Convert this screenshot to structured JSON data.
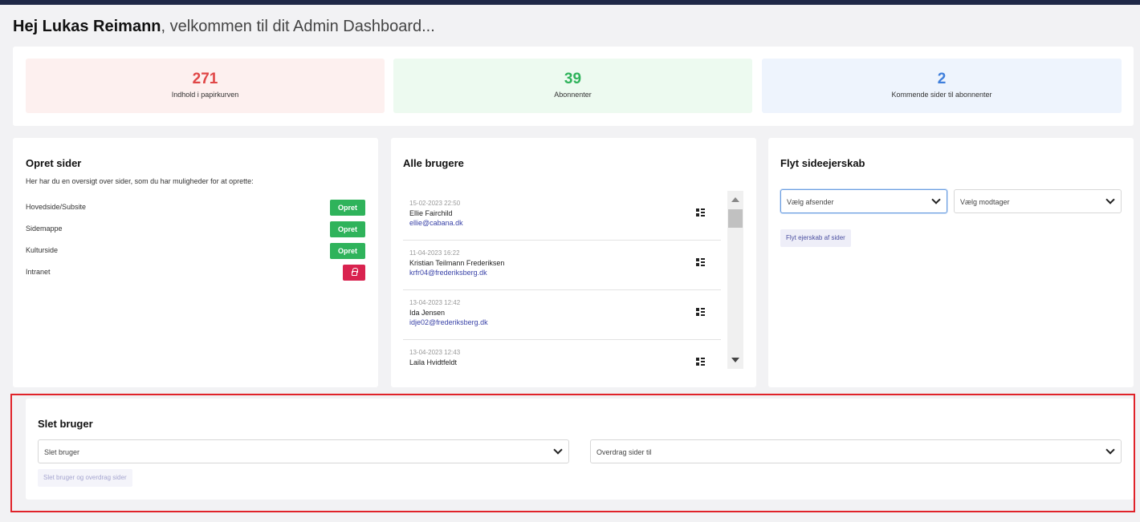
{
  "greeting": {
    "name": "Hej Lukas Reimann",
    "rest": ", velkommen til dit Admin Dashboard..."
  },
  "stats": [
    {
      "value": "271",
      "label": "Indhold i papirkurven",
      "color": "#e04747"
    },
    {
      "value": "39",
      "label": "Abonnenter",
      "color": "#2fb35b"
    },
    {
      "value": "2",
      "label": "Kommende sider til abonnenter",
      "color": "#3f7fdc"
    }
  ],
  "opret": {
    "title": "Opret sider",
    "description": "Her har du en oversigt over sider, som du har muligheder for at oprette:",
    "rows": [
      {
        "name": "Hovedside/Subsite",
        "button": "Opret",
        "locked": false
      },
      {
        "name": "Sidemappe",
        "button": "Opret",
        "locked": false
      },
      {
        "name": "Kulturside",
        "button": "Opret",
        "locked": false
      },
      {
        "name": "Intranet",
        "button": "",
        "locked": true,
        "icon": "lock-icon"
      }
    ]
  },
  "users": {
    "title": "Alle brugere",
    "items": [
      {
        "date": "15-02-2023 22:50",
        "name": "Ellie Fairchild",
        "email": "ellie@cabana.dk"
      },
      {
        "date": "11-04-2023 16:22",
        "name": "Kristian Teilmann Frederiksen",
        "email": "krfr04@frederiksberg.dk"
      },
      {
        "date": "13-04-2023 12:42",
        "name": "Ida Jensen",
        "email": "idje02@frederiksberg.dk"
      },
      {
        "date": "13-04-2023 12:43",
        "name": "Laila Hvidtfeldt",
        "email": ""
      }
    ],
    "row_icon": "qr-grid-icon"
  },
  "flyt": {
    "title": "Flyt sideejerskab",
    "sender_select": "Vælg afsender",
    "receiver_select": "Vælg modtager",
    "button": "Flyt ejerskab af sider"
  },
  "slet": {
    "title": "Slet bruger",
    "user_select": "Slet bruger",
    "transfer_select": "Overdrag sider til",
    "button": "Slet bruger og overdrag sider"
  },
  "colors": {
    "topbar": "#1f2847",
    "green": "#2fb35b",
    "red": "#e04747",
    "blue": "#3f7fdc",
    "lock_button": "#d9234f",
    "highlight_border": "#e0232a",
    "link": "#3a43a8"
  }
}
